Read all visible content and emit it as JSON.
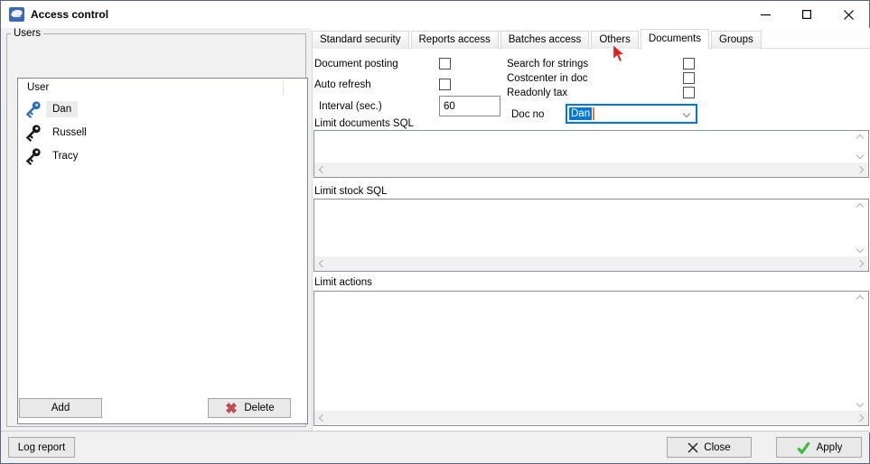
{
  "window": {
    "title": "Access control"
  },
  "users_panel": {
    "group_label": "Users",
    "column_header": "User",
    "users": [
      {
        "name": "Dan",
        "selected": true
      },
      {
        "name": "Russell",
        "selected": false
      },
      {
        "name": "Tracy",
        "selected": false
      }
    ],
    "add_label": "Add",
    "delete_label": "Delete"
  },
  "tabs": [
    {
      "label": "Standard security",
      "active": false
    },
    {
      "label": "Reports access",
      "active": false
    },
    {
      "label": "Batches access",
      "active": false
    },
    {
      "label": "Others",
      "active": false
    },
    {
      "label": "Documents",
      "active": true
    },
    {
      "label": "Groups",
      "active": false
    }
  ],
  "documents_tab": {
    "checks_left": [
      {
        "label": "Document posting",
        "checked": false
      },
      {
        "label": "Auto refresh",
        "checked": false
      }
    ],
    "checks_right": [
      {
        "label": "Search for strings",
        "checked": false
      },
      {
        "label": "Costcenter in doc",
        "checked": false
      },
      {
        "label": "Readonly tax",
        "checked": false
      }
    ],
    "interval_label": "Interval (sec.)",
    "interval_value": "60",
    "doc_no_label": "Doc no",
    "doc_no_value": "Dan",
    "sections": [
      {
        "label": "Limit documents SQL",
        "value": ""
      },
      {
        "label": "Limit stock SQL",
        "value": ""
      },
      {
        "label": "Limit actions",
        "value": ""
      }
    ]
  },
  "footer": {
    "log_report_label": "Log report",
    "close_label": "Close",
    "apply_label": "Apply"
  },
  "colors": {
    "accent": "#0078d7",
    "caret_orange": "#f07830",
    "delete_red": "#c94f4f",
    "apply_green": "#3fbb3f",
    "key_blue": "#2e6db4",
    "key_black": "#1a1a1a"
  }
}
